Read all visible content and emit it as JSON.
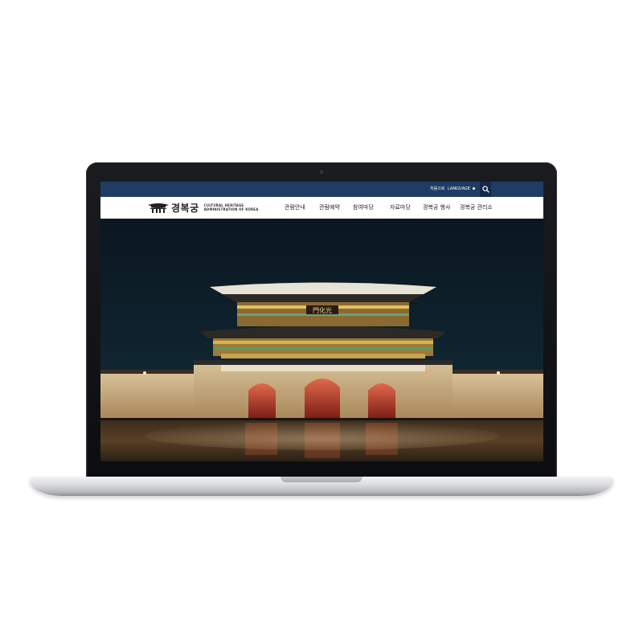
{
  "colors": {
    "topbar": "#1f3c64",
    "accent": "#132a4a"
  },
  "utility": {
    "home_label": "처음으로",
    "language_label": "LANGUAGE",
    "search_icon": "search-icon"
  },
  "logo": {
    "title": "경복궁",
    "subtitle_line1": "CULTURAL HERITAGE",
    "subtitle_line2": "ADMINISTRATION OF KOREA"
  },
  "nav": {
    "items": [
      {
        "label": "관람안내"
      },
      {
        "label": "관람예약"
      },
      {
        "label": "참여마당"
      },
      {
        "label": "자료마당"
      },
      {
        "label": "경복궁 행사"
      },
      {
        "label": "경복궁 관리소"
      }
    ]
  },
  "hero": {
    "image": "gwanghwamun-gate-night",
    "signboard": "門化光"
  }
}
